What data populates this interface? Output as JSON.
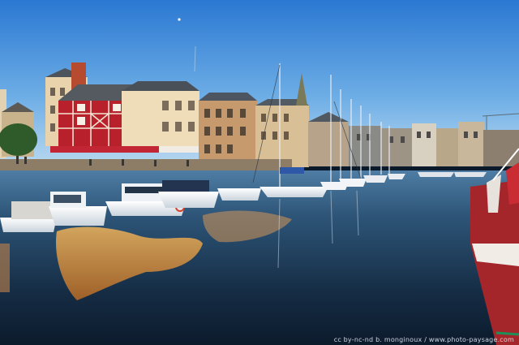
{
  "photo": {
    "subject": "harbour with moored sailboats and half-timbered quayside buildings at sunset",
    "credit": "cc by-nc-nd      b. monginoux / www.photo-paysage.com"
  },
  "colors": {
    "sky_top": "#2f7fd6",
    "sky_bottom": "#a9d0ee",
    "water_dark": "#0f2236",
    "water_mid": "#2a5478",
    "reflection_gold": "#e7a34a",
    "timber_red": "#b3242f",
    "stone_cream": "#e9d6b4",
    "slate_roof": "#4b5560"
  }
}
